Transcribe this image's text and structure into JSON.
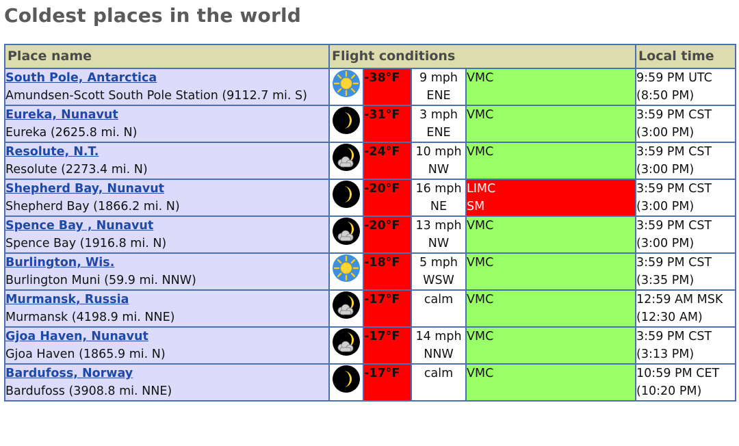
{
  "page": {
    "title": "Coldest places in the world"
  },
  "headers": {
    "place": "Place name",
    "flight": "Flight conditions",
    "time": "Local time"
  },
  "colors": {
    "temp_bg": "#ff0000",
    "vmc_bg": "#99ff66",
    "limc_bg": "#ff0000",
    "place_bg": "#dcdcfa",
    "header_bg": "#dcdcae",
    "link": "#1f49a6",
    "border": "#4a6fb5"
  },
  "rows": [
    {
      "link": "South Pole, Antarctica",
      "station": "Amundsen-Scott South Pole Station (9112.7 mi. S)",
      "icon": "sun-icon",
      "temp": "-38°F",
      "wind_speed": "9 mph",
      "wind_dir": "ENE",
      "cond_1": "VMC",
      "cond_2": "",
      "cond_class": "vmc",
      "time": "9:59 PM UTC",
      "time_alt": "(8:50 PM)"
    },
    {
      "link": "Eureka, Nunavut",
      "station": "Eureka (2625.8 mi. N)",
      "icon": "moon-icon",
      "temp": "-31°F",
      "wind_speed": "3 mph",
      "wind_dir": "ENE",
      "cond_1": "VMC",
      "cond_2": "",
      "cond_class": "vmc",
      "time": "3:59 PM CST",
      "time_alt": "(3:00 PM)"
    },
    {
      "link": "Resolute, N.T.",
      "station": "Resolute (2273.4 mi. N)",
      "icon": "moon-cloud-icon",
      "temp": "-24°F",
      "wind_speed": "10 mph",
      "wind_dir": "NW",
      "cond_1": "VMC",
      "cond_2": "",
      "cond_class": "vmc",
      "time": "3:59 PM CST",
      "time_alt": "(3:00 PM)"
    },
    {
      "link": "Shepherd Bay, Nunavut",
      "station": "Shepherd Bay (1866.2 mi. N)",
      "icon": "moon-icon",
      "temp": "-20°F",
      "wind_speed": "16 mph",
      "wind_dir": "NE",
      "cond_1": "LIMC",
      "cond_2": "SM",
      "cond_class": "limc",
      "time": "3:59 PM CST",
      "time_alt": "(3:00 PM)"
    },
    {
      "link": "Spence Bay , Nunavut",
      "station": "Spence Bay (1916.8 mi. N)",
      "icon": "moon-cloud-icon",
      "temp": "-20°F",
      "wind_speed": "13 mph",
      "wind_dir": "NW",
      "cond_1": "VMC",
      "cond_2": "",
      "cond_class": "vmc",
      "time": "3:59 PM CST",
      "time_alt": "(3:00 PM)"
    },
    {
      "link": "Burlington, Wis.",
      "station": "Burlington Muni (59.9 mi. NNW)",
      "icon": "sun-icon",
      "temp": "-18°F",
      "wind_speed": "5 mph",
      "wind_dir": "WSW",
      "cond_1": "VMC",
      "cond_2": "",
      "cond_class": "vmc",
      "time": "3:59 PM CST",
      "time_alt": "(3:35 PM)"
    },
    {
      "link": "Murmansk, Russia",
      "station": "Murmansk (4198.9 mi. NNE)",
      "icon": "moon-cloud-icon",
      "temp": "-17°F",
      "wind_speed": "calm",
      "wind_dir": "",
      "cond_1": "VMC",
      "cond_2": "",
      "cond_class": "vmc",
      "time": "12:59 AM MSK",
      "time_alt": "(12:30 AM)"
    },
    {
      "link": "Gjoa Haven, Nunavut",
      "station": "Gjoa Haven (1865.9 mi. N)",
      "icon": "moon-cloud-icon",
      "temp": "-17°F",
      "wind_speed": "14 mph",
      "wind_dir": "NNW",
      "cond_1": "VMC",
      "cond_2": "",
      "cond_class": "vmc",
      "time": "3:59 PM CST",
      "time_alt": "(3:13 PM)"
    },
    {
      "link": "Bardufoss, Norway",
      "station": "Bardufoss (3908.8 mi. NNE)",
      "icon": "moon-icon",
      "temp": "-17°F",
      "wind_speed": "calm",
      "wind_dir": "",
      "cond_1": "VMC",
      "cond_2": "",
      "cond_class": "vmc",
      "time": "10:59 PM CET",
      "time_alt": "(10:20 PM)"
    }
  ]
}
